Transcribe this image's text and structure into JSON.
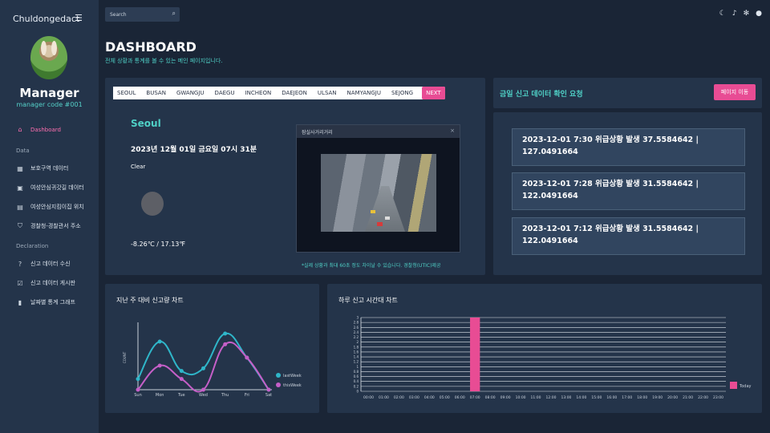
{
  "sidebar": {
    "brand": "Chuldongedact",
    "manager_name": "Manager",
    "manager_code": "manager code #001",
    "items_top": [
      {
        "label": "Dashboard",
        "icon": "home-icon"
      }
    ],
    "section_data": "Data",
    "items_data": [
      {
        "label": "보호구역 데이터",
        "icon": "grid-icon"
      },
      {
        "label": "여성안심귀갓길 데이터",
        "icon": "map-icon"
      },
      {
        "label": "여성안심지킴이집 위치",
        "icon": "pin-icon"
      },
      {
        "label": "경찰청-경찰관서 주소",
        "icon": "shield-icon"
      }
    ],
    "section_declaration": "Declaration",
    "items_declaration": [
      {
        "label": "신고 데이터 수신",
        "icon": "question-icon"
      },
      {
        "label": "신고 데이터 게시판",
        "icon": "clipboard-icon"
      },
      {
        "label": "날짜별 통계 그래프",
        "icon": "bar-chart-icon"
      }
    ]
  },
  "search": {
    "placeholder": "Search"
  },
  "header": {
    "title": "DASHBOARD",
    "subtitle": "전체 상황과 통계를 볼 수 있는 메인 페이지입니다."
  },
  "cities": {
    "tabs": [
      "SEOUL",
      "BUSAN",
      "GWANGJU",
      "DAEGU",
      "INCHEON",
      "DAEJEON",
      "ULSAN",
      "NAMYANGJU",
      "SEJONG"
    ],
    "next_label": "NEXT",
    "selected_city": "Seoul",
    "datetime": "2023년 12월 01일 금요일 07시 31분",
    "condition": "Clear",
    "temperature": "-8.26℃ / 17.13℉",
    "cctv_title": "잠실사거리거리",
    "cctv_close": "×",
    "cctv_note": "*실제 상황과 최대 60초 정도 차이날 수 있습니다. 경찰청(UTIC)제공"
  },
  "reports": {
    "title": "금일 신고 데이터 확인 요청",
    "button_label": "페이지 이동",
    "items": [
      {
        "line1": "2023-12-01 7:30 위급상황 발생 37.5584642 |",
        "line2": "127.0491664"
      },
      {
        "line1": "2023-12-01 7:28 위급상황 발생 31.5584642 |",
        "line2": "122.0491664"
      },
      {
        "line1": "2023-12-01 7:12 위급상황 발생 31.5584642 |",
        "line2": "122.0491664"
      }
    ]
  },
  "chart_data": [
    {
      "type": "line",
      "title": "지난 주 대비 신고량 차트",
      "ylabel": "COUNT",
      "categories": [
        "Sun",
        "Mon",
        "Tue",
        "Wed",
        "Thu",
        "Fri",
        "Sat"
      ],
      "series": [
        {
          "name": "lastWeek",
          "color": "#2fb6c9",
          "values": [
            0.2,
            0.9,
            0.35,
            0.4,
            1.05,
            0.6,
            0
          ]
        },
        {
          "name": "thisWeek",
          "color": "#c55fc8",
          "values": [
            0,
            0.45,
            0.2,
            0,
            0.85,
            0.6,
            0
          ]
        }
      ],
      "ylim": [
        0,
        1.2
      ],
      "legend": "right"
    },
    {
      "type": "bar",
      "title": "하루 신고 시간대 차트",
      "categories": [
        "00:00",
        "01:00",
        "02:00",
        "03:00",
        "04:00",
        "05:00",
        "06:00",
        "07:00",
        "08:00",
        "09:00",
        "10:00",
        "11:00",
        "12:00",
        "13:00",
        "14:00",
        "15:00",
        "16:00",
        "17:00",
        "18:00",
        "19:00",
        "20:00",
        "21:00",
        "22:00",
        "23:00"
      ],
      "series": [
        {
          "name": "Today",
          "color": "#e84c94",
          "values": [
            0,
            0,
            0,
            0,
            0,
            0,
            0,
            3,
            0,
            0,
            0,
            0,
            0,
            0,
            0,
            0,
            0,
            0,
            0,
            0,
            0,
            0,
            0,
            0
          ]
        }
      ],
      "yticks": [
        "0",
        "0.2",
        "0.4",
        "0.6",
        "0.8",
        "1",
        "1.2",
        "1.4",
        "1.6",
        "1.8",
        "2",
        "2.2",
        "2.4",
        "2.6",
        "2.8",
        "3"
      ],
      "ylim": [
        0,
        3
      ],
      "legend": "right"
    }
  ]
}
